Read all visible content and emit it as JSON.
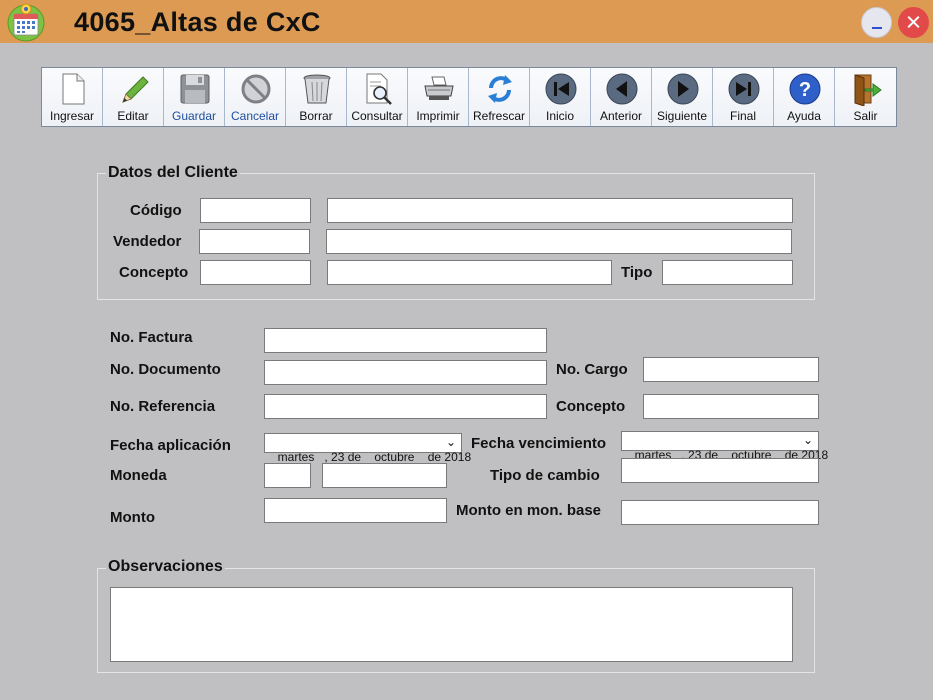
{
  "window": {
    "title": "4065_Altas de CxC"
  },
  "toolbar": {
    "buttons": [
      {
        "label": "Ingresar",
        "icon": "new-document-icon"
      },
      {
        "label": "Editar",
        "icon": "pencil-icon"
      },
      {
        "label": "Guardar",
        "icon": "save-disk-icon"
      },
      {
        "label": "Cancelar",
        "icon": "cancel-icon"
      },
      {
        "label": "Borrar",
        "icon": "trash-bin-icon"
      },
      {
        "label": "Consultar",
        "icon": "search-document-icon"
      },
      {
        "label": "Imprimir",
        "icon": "printer-icon"
      },
      {
        "label": "Refrescar",
        "icon": "refresh-icon"
      },
      {
        "label": "Inicio",
        "icon": "first-record-icon"
      },
      {
        "label": "Anterior",
        "icon": "previous-record-icon"
      },
      {
        "label": "Siguiente",
        "icon": "next-record-icon"
      },
      {
        "label": "Final",
        "icon": "last-record-icon"
      },
      {
        "label": "Ayuda",
        "icon": "help-icon"
      },
      {
        "label": "Salir",
        "icon": "exit-door-icon"
      }
    ]
  },
  "cliente": {
    "group_title": "Datos del Cliente",
    "codigo_label": "Código",
    "vendedor_label": "Vendedor",
    "concepto_label": "Concepto",
    "tipo_label": "Tipo"
  },
  "documento": {
    "factura_label": "No. Factura",
    "documento_label": "No. Documento",
    "cargo_label": "No. Cargo",
    "referencia_label": "No. Referencia",
    "concepto_label": "Concepto",
    "fecha_aplicacion_label": "Fecha aplicación",
    "fecha_aplicacion_value": "martes   , 23 de    octubre    de 2018",
    "fecha_vencimiento_label": "Fecha vencimiento",
    "fecha_vencimiento_value": "martes   , 23 de    octubre    de 2018",
    "moneda_label": "Moneda",
    "tipo_cambio_label": "Tipo de cambio",
    "monto_label": "Monto",
    "monto_base_label": "Monto en mon. base"
  },
  "observaciones": {
    "group_title": "Observaciones"
  },
  "colors": {
    "titlebar": "#dd9a52",
    "background": "#c0c0c2",
    "accent_blue": "#1d4e9e"
  }
}
